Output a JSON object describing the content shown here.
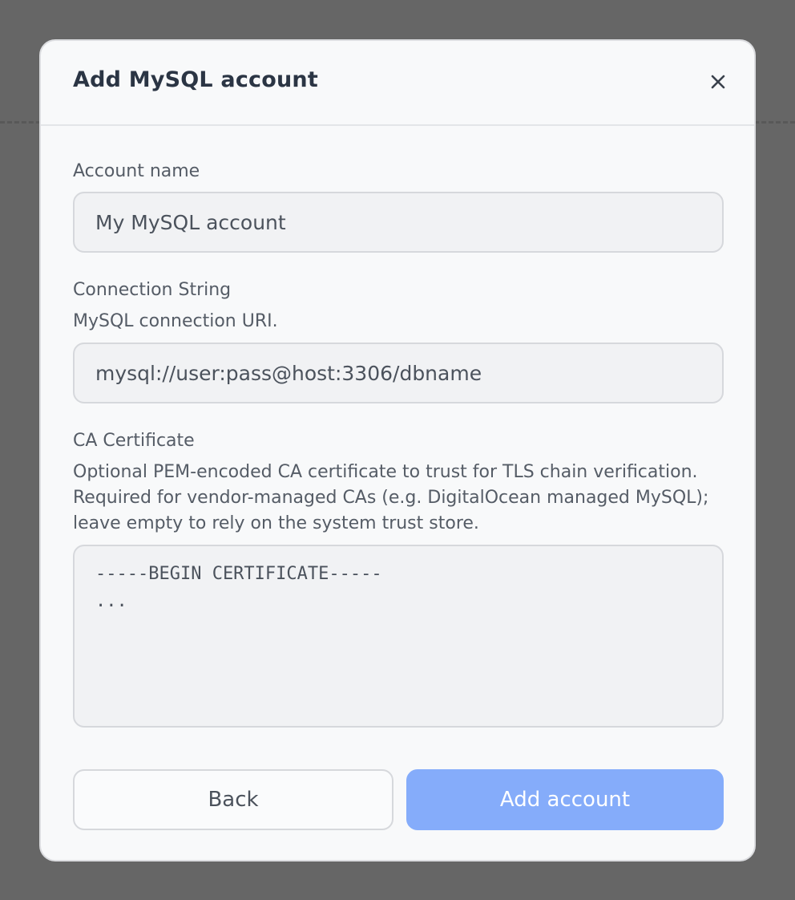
{
  "modal": {
    "title": "Add MySQL account",
    "close_icon": "close-icon"
  },
  "fields": {
    "account_name": {
      "label": "Account name",
      "placeholder": "My MySQL account",
      "value": ""
    },
    "connection_string": {
      "label": "Connection String",
      "help": "MySQL connection URI.",
      "placeholder": "mysql://user:pass@host:3306/dbname",
      "value": ""
    },
    "ca_certificate": {
      "label": "CA Certificate",
      "help_lines": [
        "Optional PEM-encoded CA certificate to trust for TLS chain verification.",
        "Required for vendor-managed CAs (e.g. DigitalOcean managed MySQL);",
        "leave empty to rely on the system trust store."
      ],
      "placeholder": "-----BEGIN CERTIFICATE-----\n...",
      "value": ""
    }
  },
  "buttons": {
    "back_label": "Back",
    "submit_label": "Add account"
  },
  "colors": {
    "overlay": "#666666",
    "modal_bg": "#f8f9fa",
    "primary_button": "#85acfa",
    "input_bg": "#f1f2f4"
  }
}
